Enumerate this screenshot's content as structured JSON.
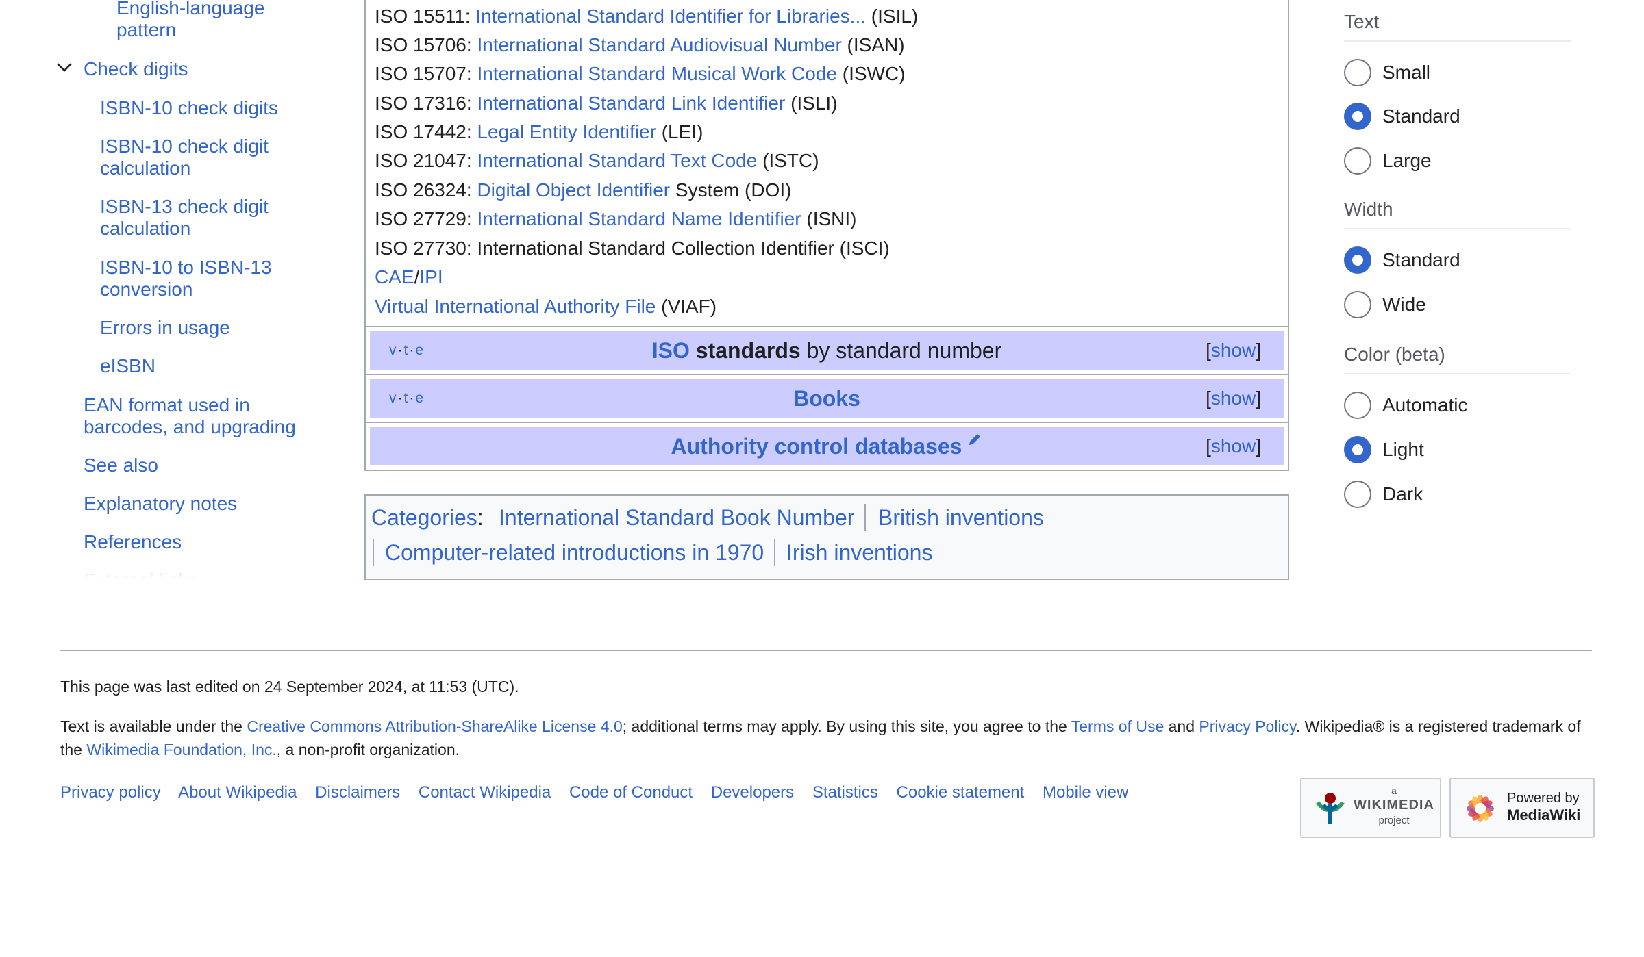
{
  "toc": {
    "items": [
      {
        "label": "English-language pattern"
      },
      {
        "label": "Check digits"
      },
      {
        "label": "ISBN-10 check digits"
      },
      {
        "label": "ISBN-10 check digit calculation"
      },
      {
        "label": "ISBN-13 check digit calculation"
      },
      {
        "label": "ISBN-10 to ISBN-13 conversion"
      },
      {
        "label": "Errors in usage"
      },
      {
        "label": "eISBN"
      },
      {
        "label": "EAN format used in barcodes, and upgrading"
      },
      {
        "label": "See also"
      },
      {
        "label": "Explanatory notes"
      },
      {
        "label": "References"
      },
      {
        "label": "External links"
      }
    ]
  },
  "identifiers": [
    {
      "prefix": "ISO 15511: ",
      "link": "International Standard Identifier for Libraries...",
      "suffix": " (ISIL)"
    },
    {
      "prefix": "ISO 15706: ",
      "link": "International Standard Audiovisual Number",
      "suffix": " (ISAN)"
    },
    {
      "prefix": "ISO 15707: ",
      "link": "International Standard Musical Work Code",
      "suffix": " (ISWC)"
    },
    {
      "prefix": "ISO 17316: ",
      "link": "International Standard Link Identifier",
      "suffix": " (ISLI)"
    },
    {
      "prefix": "ISO 17442: ",
      "link": "Legal Entity Identifier",
      "suffix": " (LEI)"
    },
    {
      "prefix": "ISO 21047: ",
      "link": "International Standard Text Code",
      "suffix": " (ISTC)"
    },
    {
      "prefix": "ISO 26324: ",
      "link": "Digital Object Identifier",
      "suffix": " System (DOI)"
    },
    {
      "prefix": "ISO 27729: ",
      "link": "International Standard Name Identifier",
      "suffix": " (ISNI)"
    },
    {
      "prefix": "ISO 27730: International Standard Collection Identifier (ISCI)",
      "link": "",
      "suffix": ""
    }
  ],
  "cae_ipi": {
    "cae": "CAE",
    "slash": "/",
    "ipi": "IPI"
  },
  "viaf": {
    "link": "Virtual International Authority File",
    "suffix": " (VIAF)"
  },
  "navboxes": {
    "vte": {
      "v": "v",
      "t": "t",
      "e": "e",
      "dot": "·"
    },
    "iso": {
      "link": "ISO",
      "bold": " standards",
      "rest": " by standard number"
    },
    "books": {
      "title": "Books"
    },
    "authority": {
      "title": "Authority control databases"
    },
    "show": {
      "open": "[",
      "label": "show",
      "close": "]"
    }
  },
  "categories": {
    "label": "Categories",
    "colon": ":",
    "items": [
      "International Standard Book Number",
      "British inventions",
      "Computer-related introductions in 1970",
      "Irish inventions"
    ]
  },
  "appearance": {
    "text": {
      "heading": "Text",
      "options": [
        "Small",
        "Standard",
        "Large"
      ],
      "selected": "Standard"
    },
    "width": {
      "heading": "Width",
      "options": [
        "Standard",
        "Wide"
      ],
      "selected": "Standard"
    },
    "color": {
      "heading": "Color (beta)",
      "options": [
        "Automatic",
        "Light",
        "Dark"
      ],
      "selected": "Light"
    },
    "accent": "#3366cc"
  },
  "footer": {
    "last_edited": "This page was last edited on 24 September 2024, at 11:53 (UTC).",
    "license": {
      "t1": "Text is available under the ",
      "cc": "Creative Commons Attribution-ShareAlike License 4.0",
      "t2": "; additional terms may apply. By using this site, you agree to the ",
      "terms": "Terms of Use",
      "t3": " and ",
      "privacy": "Privacy Policy",
      "t4": ". Wikipedia® is a registered trademark of the ",
      "wmf": "Wikimedia Foundation, Inc.",
      "t5": ", a non-profit organization."
    },
    "places": [
      "Privacy policy",
      "About Wikipedia",
      "Disclaimers",
      "Contact Wikipedia",
      "Code of Conduct",
      "Developers",
      "Statistics",
      "Cookie statement",
      "Mobile view"
    ],
    "wikimedia_badge": {
      "small": "a",
      "big": "WIKIMEDIA",
      "sub": "project"
    },
    "mediawiki_badge": {
      "top": "Powered by",
      "bottom": "MediaWiki"
    }
  }
}
